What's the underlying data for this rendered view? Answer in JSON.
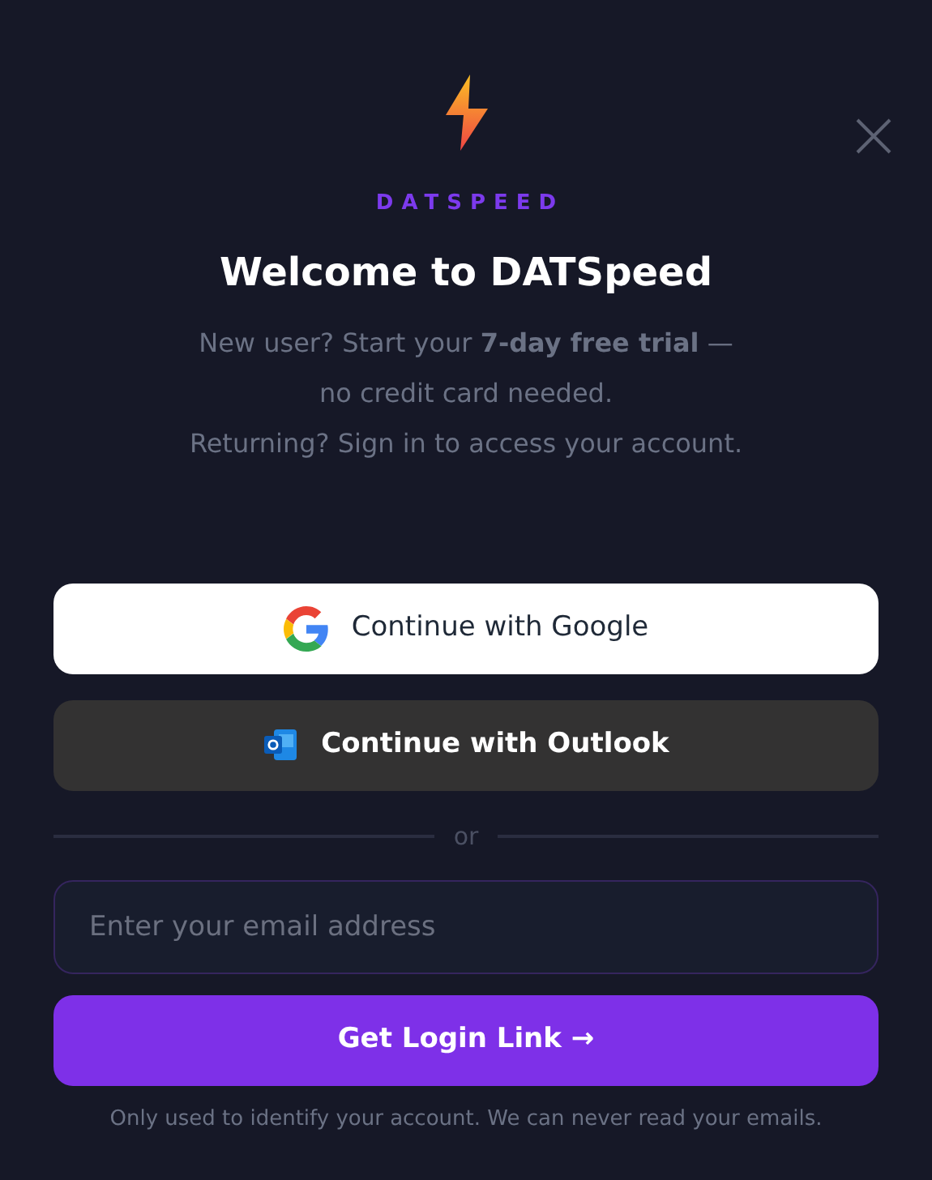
{
  "brand": "DATSPEED",
  "title": "Welcome to DATSpeed",
  "intro_lines": [
    "New user? Start your **7-day free trial** —",
    "no credit card needed.",
    "Returning? Sign in to access your account."
  ],
  "providers": [
    {
      "kind": "google",
      "label": "Continue with Google"
    },
    {
      "kind": "outlook",
      "label": "Continue with Outlook"
    }
  ],
  "divider": "or",
  "email": {
    "placeholder": "Enter your email address"
  },
  "submit": "Get Login Link →",
  "footnote": "Only used to identify your account. We can never read your emails."
}
